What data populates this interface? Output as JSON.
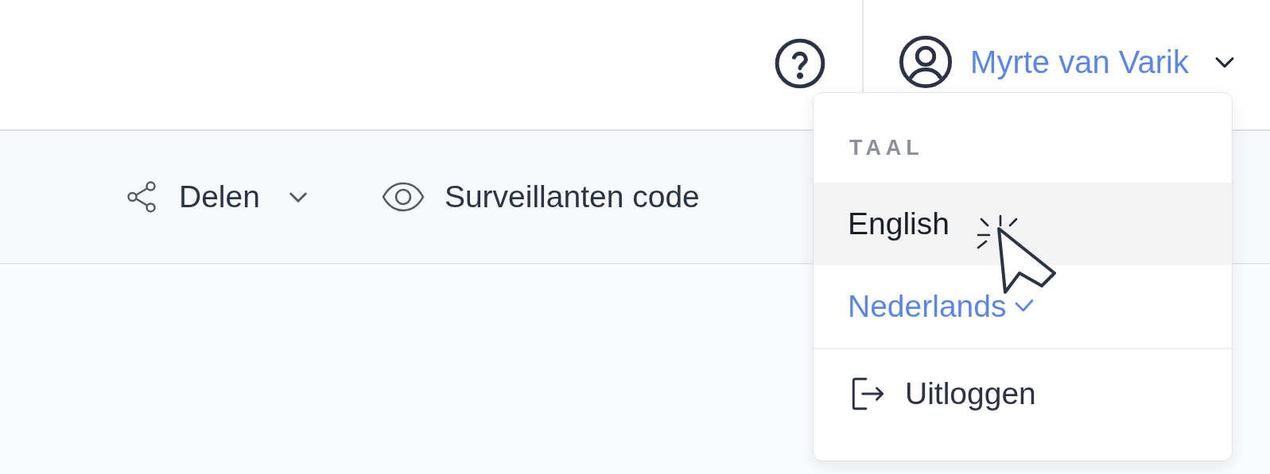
{
  "header": {
    "user": {
      "name": "Myrte van Varik",
      "menu_open": true
    }
  },
  "toolbar": {
    "items": [
      {
        "kind": "share",
        "label": "Delen",
        "has_dropdown": true
      },
      {
        "kind": "eye",
        "label": "Surveillanten code",
        "has_dropdown": false
      }
    ]
  },
  "user_menu": {
    "section_title": "TAAL",
    "languages": [
      {
        "label": "English",
        "selected": false,
        "highlighted": true
      },
      {
        "label": "Nederlands",
        "selected": true,
        "highlighted": false
      }
    ],
    "logout": {
      "label": "Uitloggen"
    }
  }
}
